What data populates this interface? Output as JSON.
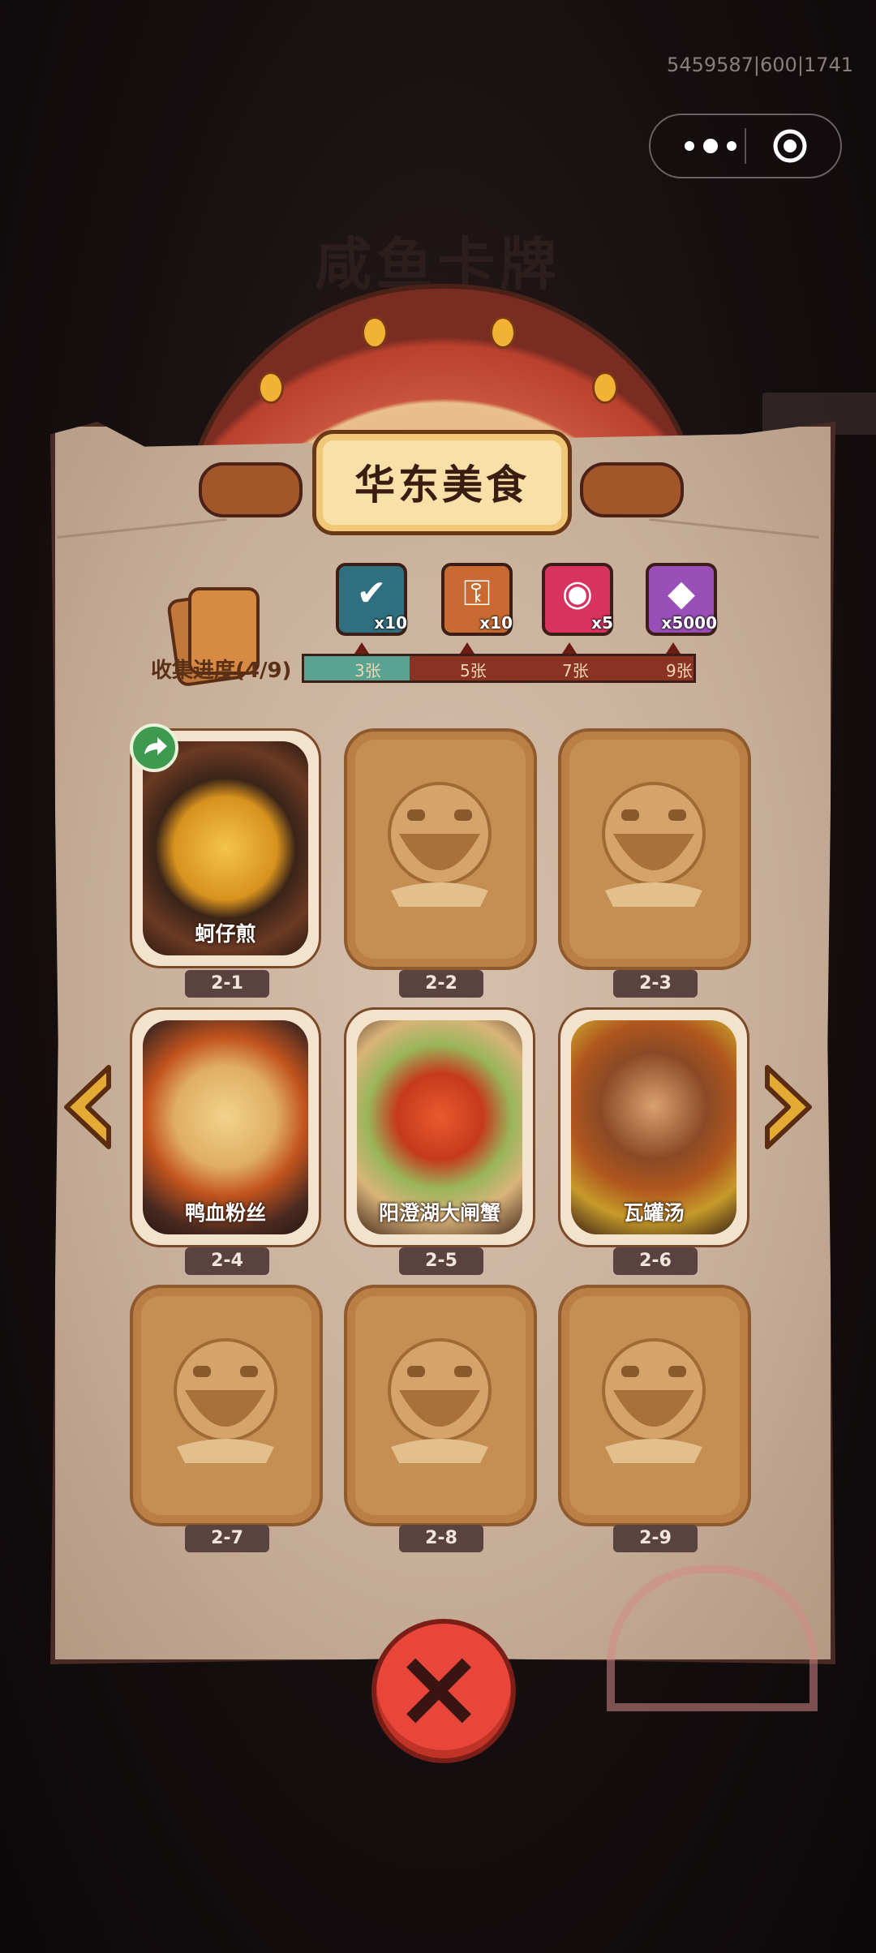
{
  "system": {
    "id_text": "5459587|600|1741"
  },
  "background": {
    "title": "咸鱼卡牌"
  },
  "panel": {
    "title": "华东美食",
    "progress_label": "收集进度(4/9)",
    "progress": {
      "collected": 4,
      "total": 9
    },
    "rewards": [
      {
        "icon": "treasure-chest-check-icon",
        "count": "x10",
        "color": "#2f6f7f"
      },
      {
        "icon": "scroll-key-icon",
        "count": "x10",
        "color": "#c86a32"
      },
      {
        "icon": "swirl-orb-icon",
        "count": "x5",
        "color": "#d8325e"
      },
      {
        "icon": "crystal-icon",
        "count": "x5000",
        "color": "#9a4fb8"
      }
    ],
    "milestones": [
      "3张",
      "5张",
      "7张",
      "9张"
    ]
  },
  "cards": [
    {
      "id": "2-1",
      "name": "蚵仔煎",
      "unlocked": true,
      "color": "#c97a1c"
    },
    {
      "id": "2-2",
      "name": "",
      "unlocked": false
    },
    {
      "id": "2-3",
      "name": "",
      "unlocked": false
    },
    {
      "id": "2-4",
      "name": "鸭血粉丝",
      "unlocked": true,
      "color": "#e5b064"
    },
    {
      "id": "2-5",
      "name": "阳澄湖大闸蟹",
      "unlocked": true,
      "color": "#d04a2a"
    },
    {
      "id": "2-6",
      "name": "瓦罐汤",
      "unlocked": true,
      "color": "#a8641f"
    },
    {
      "id": "2-7",
      "name": "",
      "unlocked": false
    },
    {
      "id": "2-8",
      "name": "",
      "unlocked": false
    },
    {
      "id": "2-9",
      "name": "",
      "unlocked": false
    }
  ]
}
